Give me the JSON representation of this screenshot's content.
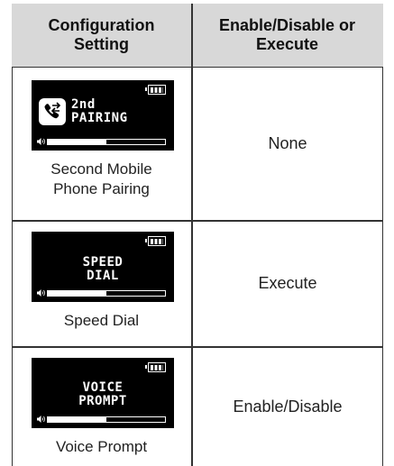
{
  "table": {
    "headers": [
      "Configuration\nSetting",
      "Enable/Disable or\nExecute"
    ],
    "header_line1": [
      "Configuration",
      "Enable/Disable or"
    ],
    "header_line2": [
      "Setting",
      "Execute"
    ],
    "rows": [
      {
        "screen_line1": "2nd",
        "screen_line2": "PAIRING",
        "caption_line1": "Second Mobile",
        "caption_line2": "Phone Pairing",
        "action": "None",
        "volume_level": 0.5
      },
      {
        "screen_line1": "SPEED",
        "screen_line2": "DIAL",
        "caption_line1": "Speed Dial",
        "caption_line2": "",
        "action": "Execute",
        "volume_level": 0.5
      },
      {
        "screen_line1": "VOICE",
        "screen_line2": "PROMPT",
        "caption_line1": "Voice Prompt",
        "caption_line2": "",
        "action": "Enable/Disable",
        "volume_level": 0.5
      }
    ]
  },
  "colors": {
    "header_bg": "#d8d8d8",
    "screen_bg": "#000000",
    "border": "#333333"
  },
  "icons": {
    "battery": "battery-full-icon",
    "speaker": "speaker-icon",
    "phone": "phone-swap-icon"
  }
}
